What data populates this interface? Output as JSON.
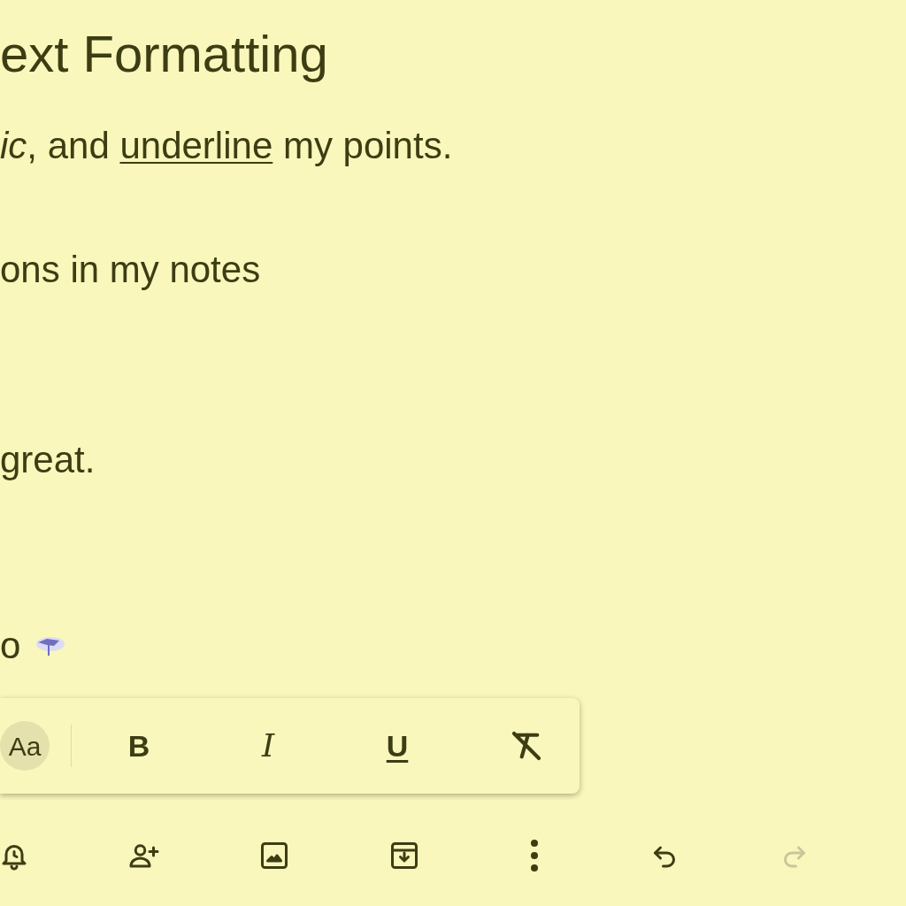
{
  "note": {
    "title": "ext Formatting",
    "lines": [
      {
        "segments": [
          {
            "text": "ic",
            "kind": "italic"
          },
          {
            "text": ", and ",
            "kind": "plain"
          },
          {
            "text": "underline",
            "kind": "underline"
          },
          {
            "text": " my points.",
            "kind": "plain"
          }
        ]
      },
      {
        "segments": [
          {
            "text": "ons in my notes",
            "kind": "plain"
          }
        ]
      },
      {
        "segments": [
          {
            "text": "great.",
            "kind": "plain"
          }
        ]
      },
      {
        "segments": [
          {
            "text": "o",
            "kind": "plain"
          },
          {
            "kind": "emoji"
          }
        ]
      }
    ]
  },
  "format_toolbar": [
    {
      "kind": "text-style",
      "label": "Aa",
      "selected": true
    },
    {
      "kind": "bold",
      "label": "B",
      "selected": false
    },
    {
      "kind": "italic",
      "label": "I",
      "selected": false
    },
    {
      "kind": "underline",
      "label": "U",
      "selected": false
    },
    {
      "kind": "clear",
      "selected": false
    }
  ],
  "bottom_toolbar": [
    {
      "kind": "reminder",
      "disabled": false
    },
    {
      "kind": "collaborator",
      "disabled": false
    },
    {
      "kind": "image",
      "disabled": false
    },
    {
      "kind": "archive",
      "disabled": false
    },
    {
      "kind": "more",
      "disabled": false
    },
    {
      "kind": "undo",
      "disabled": false
    },
    {
      "kind": "redo",
      "disabled": true
    }
  ]
}
